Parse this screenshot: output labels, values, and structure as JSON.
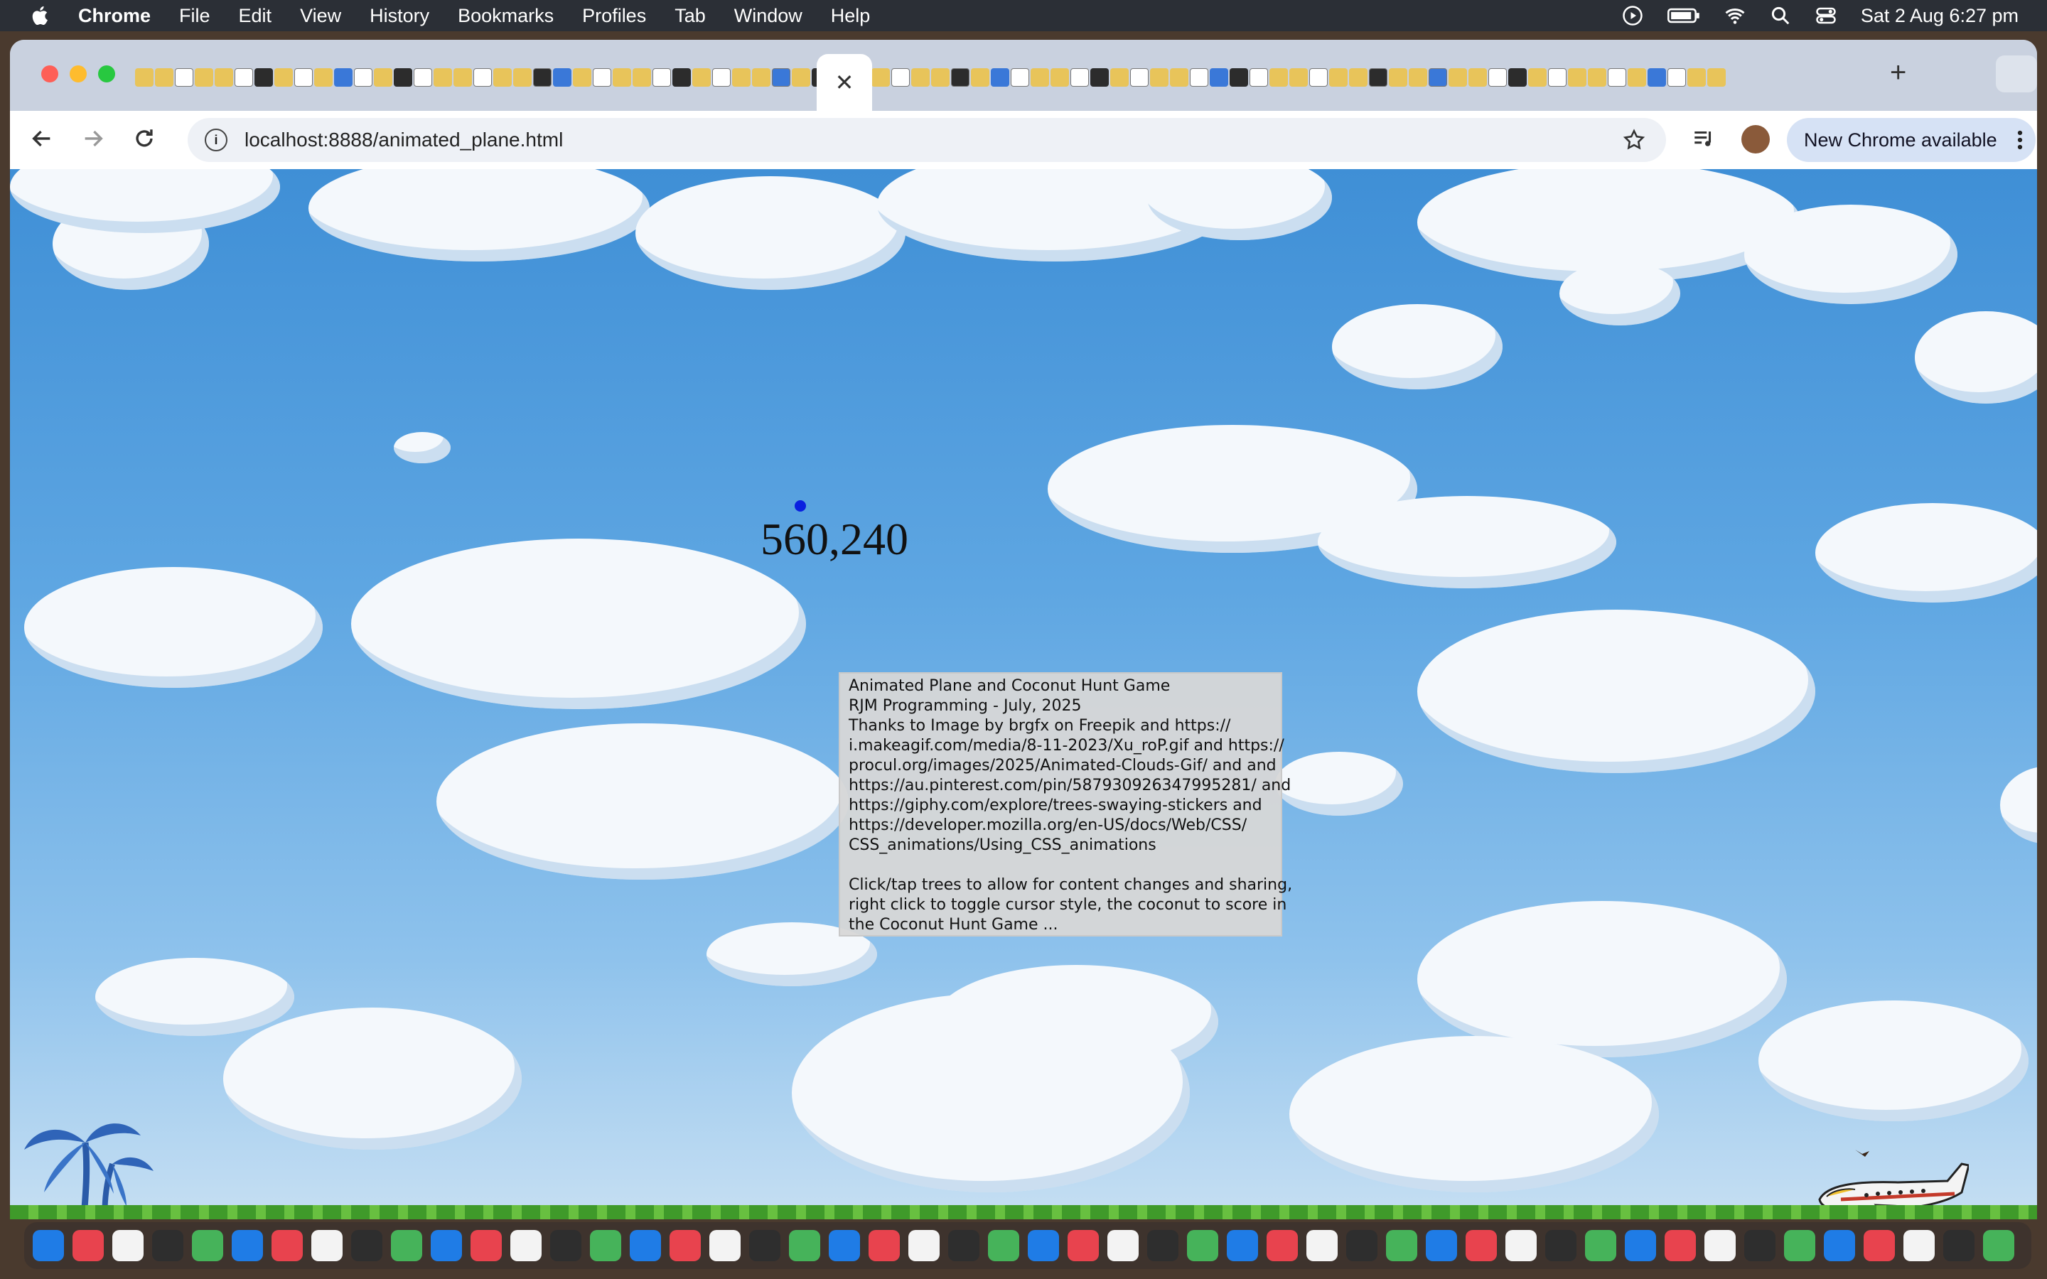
{
  "menubar": {
    "app_name": "Chrome",
    "menus": [
      "File",
      "Edit",
      "View",
      "History",
      "Bookmarks",
      "Profiles",
      "Tab",
      "Window",
      "Help"
    ],
    "clock": "Sat 2 Aug  6:27 pm"
  },
  "browser": {
    "close_tab_glyph": "✕",
    "new_tab_glyph": "+",
    "url": "localhost:8888/animated_plane.html",
    "update_button": "New Chrome available"
  },
  "page": {
    "coordinates": "560,240",
    "info_lines": [
      "Animated Plane and Coconut Hunt Game",
      "RJM Programming - July, 2025",
      "Thanks to Image by brgfx on Freepik and https://",
      "i.makeagif.com/media/8-11-2023/Xu_roP.gif and https://",
      "procul.org/images/2025/Animated-Clouds-Gif/ and  and",
      "https://au.pinterest.com/pin/587930926347995281/ and",
      "https://giphy.com/explore/trees-swaying-stickers and",
      "https://developer.mozilla.org/en-US/docs/Web/CSS/",
      "CSS_animations/Using_CSS_animations",
      "",
      "Click/tap trees to allow for content changes and sharing,",
      "right click to toggle cursor style, the coconut to score in",
      "the Coconut Hunt Game ..."
    ]
  },
  "colors": {
    "sky_top": "#3f8fd6",
    "dot": "#0a1fe0",
    "menubar_bg": "#2b2f36"
  },
  "icons": [
    "apple-icon",
    "play-icon",
    "battery-icon",
    "wifi-icon",
    "search-icon",
    "control-center-icon",
    "back-icon",
    "forward-icon",
    "reload-icon",
    "site-info-icon",
    "star-icon",
    "media-icon",
    "profile-avatar",
    "more-icon",
    "palm-tree-icon",
    "coconut-icon",
    "airplane-icon",
    "bird-icon"
  ]
}
